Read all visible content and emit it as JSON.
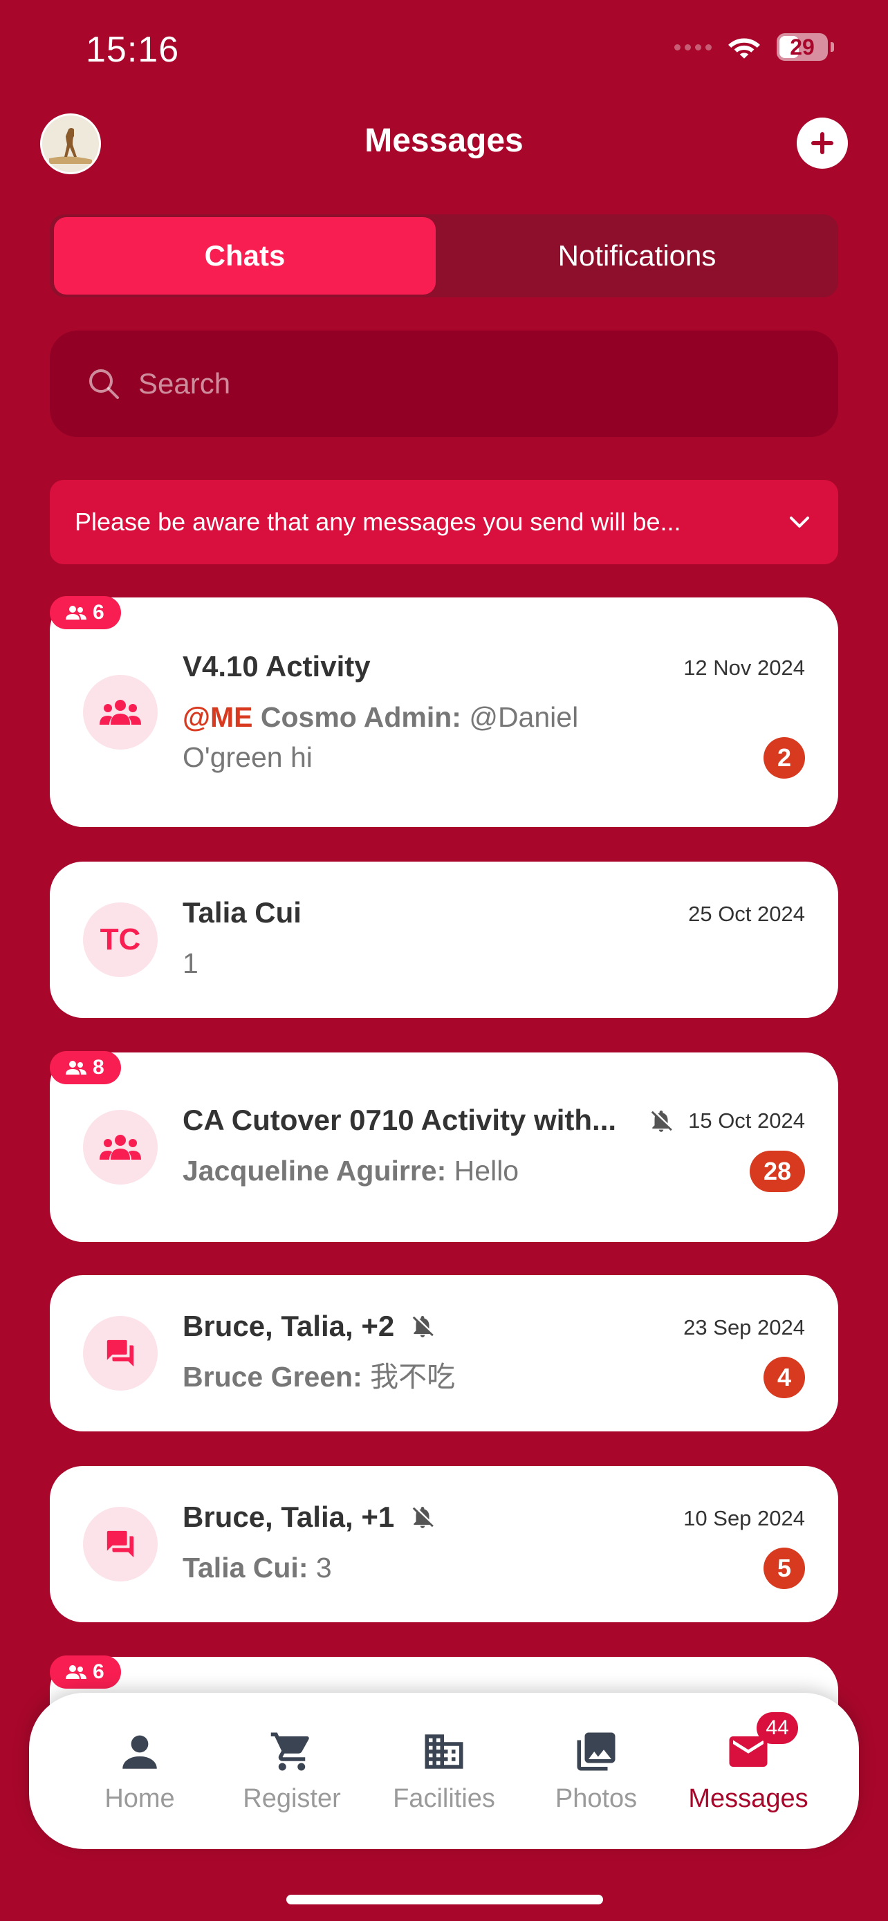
{
  "status_bar": {
    "time": "15:16",
    "battery": "29"
  },
  "header": {
    "title": "Messages"
  },
  "tabs": [
    {
      "label": "Chats",
      "active": true
    },
    {
      "label": "Notifications",
      "active": false
    }
  ],
  "search": {
    "placeholder": "Search"
  },
  "warning": {
    "text": "Please be aware that any messages you send will be..."
  },
  "chats": [
    {
      "group_count": "6",
      "title": "V4.10 Activity",
      "date": "12 Nov 2024",
      "mention": "@ME",
      "sender": "Cosmo Admin:",
      "message": "@Daniel O'green hi",
      "unread": "2",
      "muted": false
    },
    {
      "initials": "TC",
      "title": "Talia Cui",
      "date": "25 Oct 2024",
      "message": "1"
    },
    {
      "group_count": "8",
      "title": "CA Cutover 0710 Activity with...",
      "date": "15 Oct 2024",
      "sender": "Jacqueline Aguirre:",
      "message": "Hello",
      "unread": "28",
      "muted": true
    },
    {
      "title": "Bruce, Talia, +2",
      "date": "23 Sep 2024",
      "sender": "Bruce Green:",
      "message": "我不吃",
      "unread": "4",
      "muted": true
    },
    {
      "title": "Bruce, Talia, +1",
      "date": "10 Sep 2024",
      "sender": "Talia Cui:",
      "message": "3",
      "unread": "5",
      "muted": true
    },
    {
      "group_count": "6"
    }
  ],
  "nav": [
    {
      "label": "Home",
      "icon": "person-icon"
    },
    {
      "label": "Register",
      "icon": "cart-icon"
    },
    {
      "label": "Facilities",
      "icon": "building-icon"
    },
    {
      "label": "Photos",
      "icon": "photos-icon"
    },
    {
      "label": "Messages",
      "icon": "mail-icon",
      "badge": "44",
      "active": true
    }
  ],
  "colors": {
    "background": "#A8072B",
    "accent": "#F91E52",
    "badge": "#D83A20"
  }
}
